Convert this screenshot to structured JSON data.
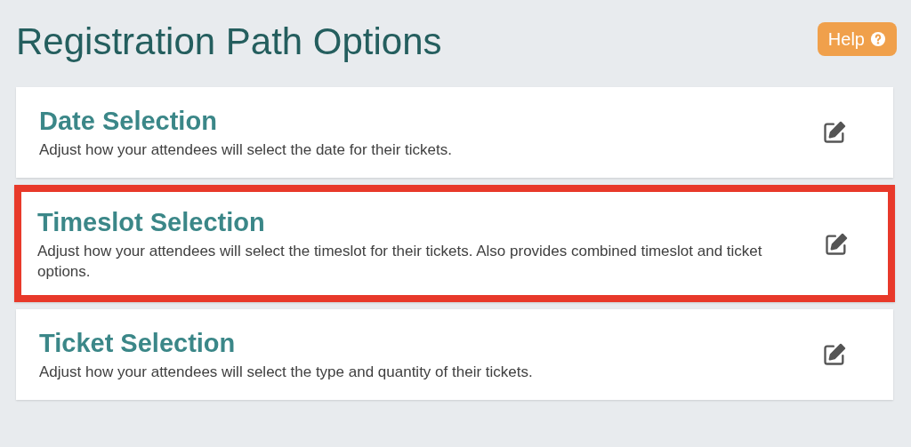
{
  "page": {
    "title": "Registration Path Options"
  },
  "help_button": {
    "label": "Help"
  },
  "options": [
    {
      "title": "Date Selection",
      "description": "Adjust how your attendees will select the date for their tickets.",
      "highlighted": false
    },
    {
      "title": "Timeslot Selection",
      "description": "Adjust how your attendees will select the timeslot for their tickets. Also provides combined timeslot and ticket options.",
      "highlighted": true
    },
    {
      "title": "Ticket Selection",
      "description": "Adjust how your attendees will select the type and quantity of their tickets.",
      "highlighted": false
    }
  ]
}
